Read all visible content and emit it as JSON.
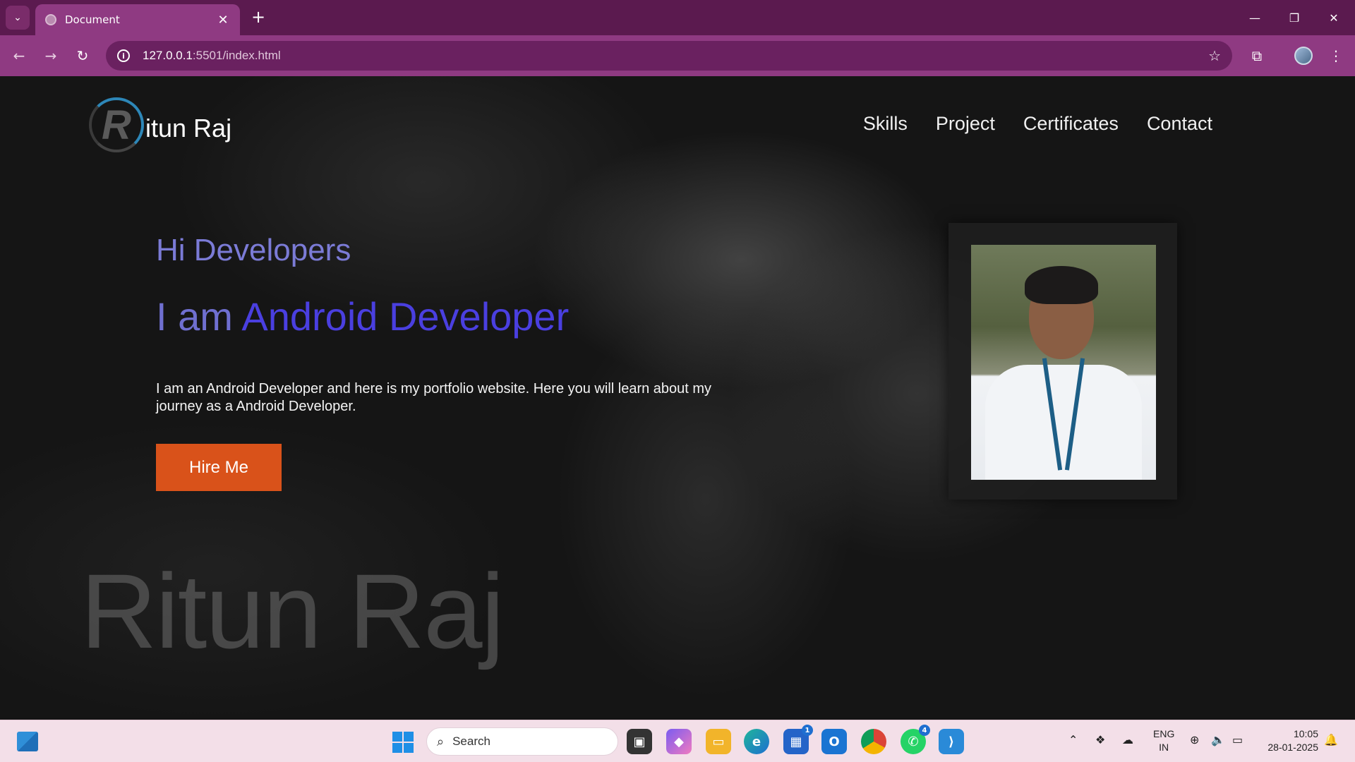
{
  "browser": {
    "tab_title": "Document",
    "url_host": "127.0.0.1",
    "url_path": ":5501/index.html",
    "new_tab_glyph": "+",
    "close_tab_glyph": "✕"
  },
  "site": {
    "logo_letter": "R",
    "logo_text": "itun Raj",
    "nav": [
      "Skills",
      "Project",
      "Certificates",
      "Contact"
    ],
    "greeting": "Hi Developers",
    "role_prefix": "I am ",
    "role_highlight": "Android Developer",
    "description": "I am an Android Developer and here is my portfolio website. Here you will learn about my journey as a Android Developer.",
    "hire_button": "Hire Me",
    "background_name": "Ritun Raj",
    "colors": {
      "greeting": "#7b7bd6",
      "highlight": "#4a3fe0",
      "button": "#d9521a"
    }
  },
  "taskbar": {
    "search_placeholder": "Search",
    "store_badge": "1",
    "whatsapp_badge": "4",
    "language_line1": "ENG",
    "language_line2": "IN",
    "time": "10:05",
    "date": "28-01-2025"
  }
}
